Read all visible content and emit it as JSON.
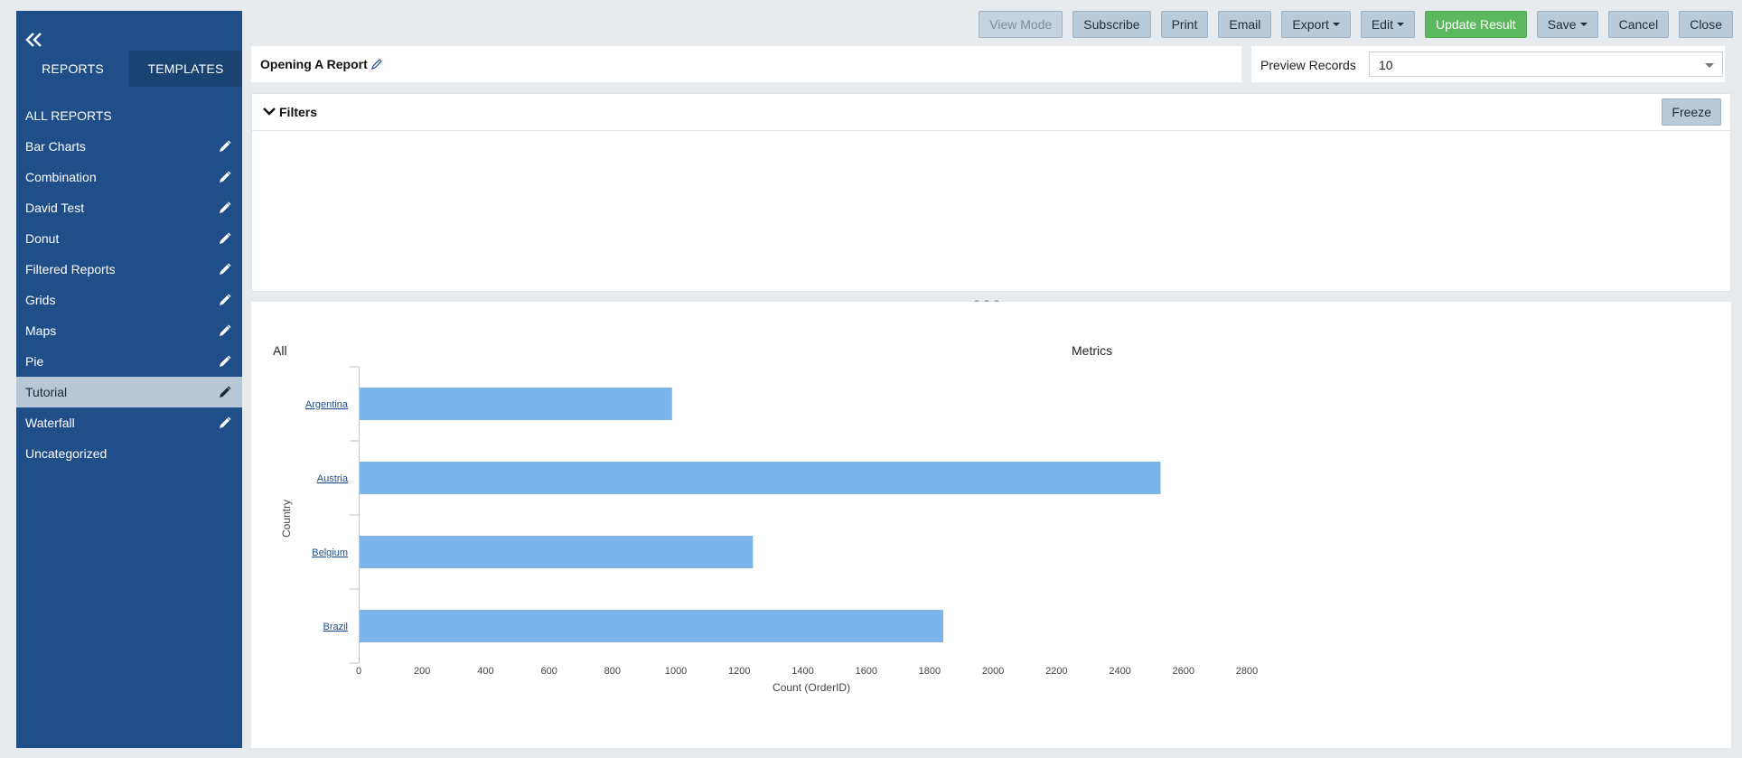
{
  "sidebar": {
    "tabs": [
      "REPORTS",
      "TEMPLATES"
    ],
    "all_reports": "ALL REPORTS",
    "categories": [
      {
        "label": "Bar Charts",
        "editable": true
      },
      {
        "label": "Combination",
        "editable": true
      },
      {
        "label": "David Test",
        "editable": true
      },
      {
        "label": "Donut",
        "editable": true
      },
      {
        "label": "Filtered Reports",
        "editable": true
      },
      {
        "label": "Grids",
        "editable": true
      },
      {
        "label": "Maps",
        "editable": true
      },
      {
        "label": "Pie",
        "editable": true
      },
      {
        "label": "Tutorial",
        "editable": true,
        "selected": true
      },
      {
        "label": "Waterfall",
        "editable": true
      },
      {
        "label": "Uncategorized",
        "editable": false
      }
    ]
  },
  "toolbar": {
    "view_mode": "View Mode",
    "subscribe": "Subscribe",
    "print": "Print",
    "email": "Email",
    "export": "Export",
    "edit": "Edit",
    "update_result": "Update Result",
    "save": "Save",
    "cancel": "Cancel",
    "close": "Close"
  },
  "report": {
    "title": "Opening A Report",
    "preview_label": "Preview Records",
    "preview_value": "10"
  },
  "filters": {
    "title": "Filters",
    "freeze": "Freeze"
  },
  "chart_header": {
    "left": "All",
    "right": "Metrics"
  },
  "colors": {
    "sidebar": "#1f4e89",
    "bar": "#7cb5ec",
    "green": "#5cb85c"
  },
  "chart_data": {
    "type": "bar",
    "orientation": "horizontal",
    "categories": [
      "Argentina",
      "Austria",
      "Belgium",
      "Brazil"
    ],
    "values": [
      985,
      2525,
      1240,
      1840
    ],
    "xlabel": "Count (OrderID)",
    "ylabel": "Country",
    "xlim": [
      0,
      2800
    ],
    "xticks": [
      "0",
      "200",
      "400",
      "600",
      "800",
      "1000",
      "1200",
      "1400",
      "1600",
      "1800",
      "2000",
      "2200",
      "2400",
      "2600",
      "2800"
    ],
    "grid": false
  }
}
